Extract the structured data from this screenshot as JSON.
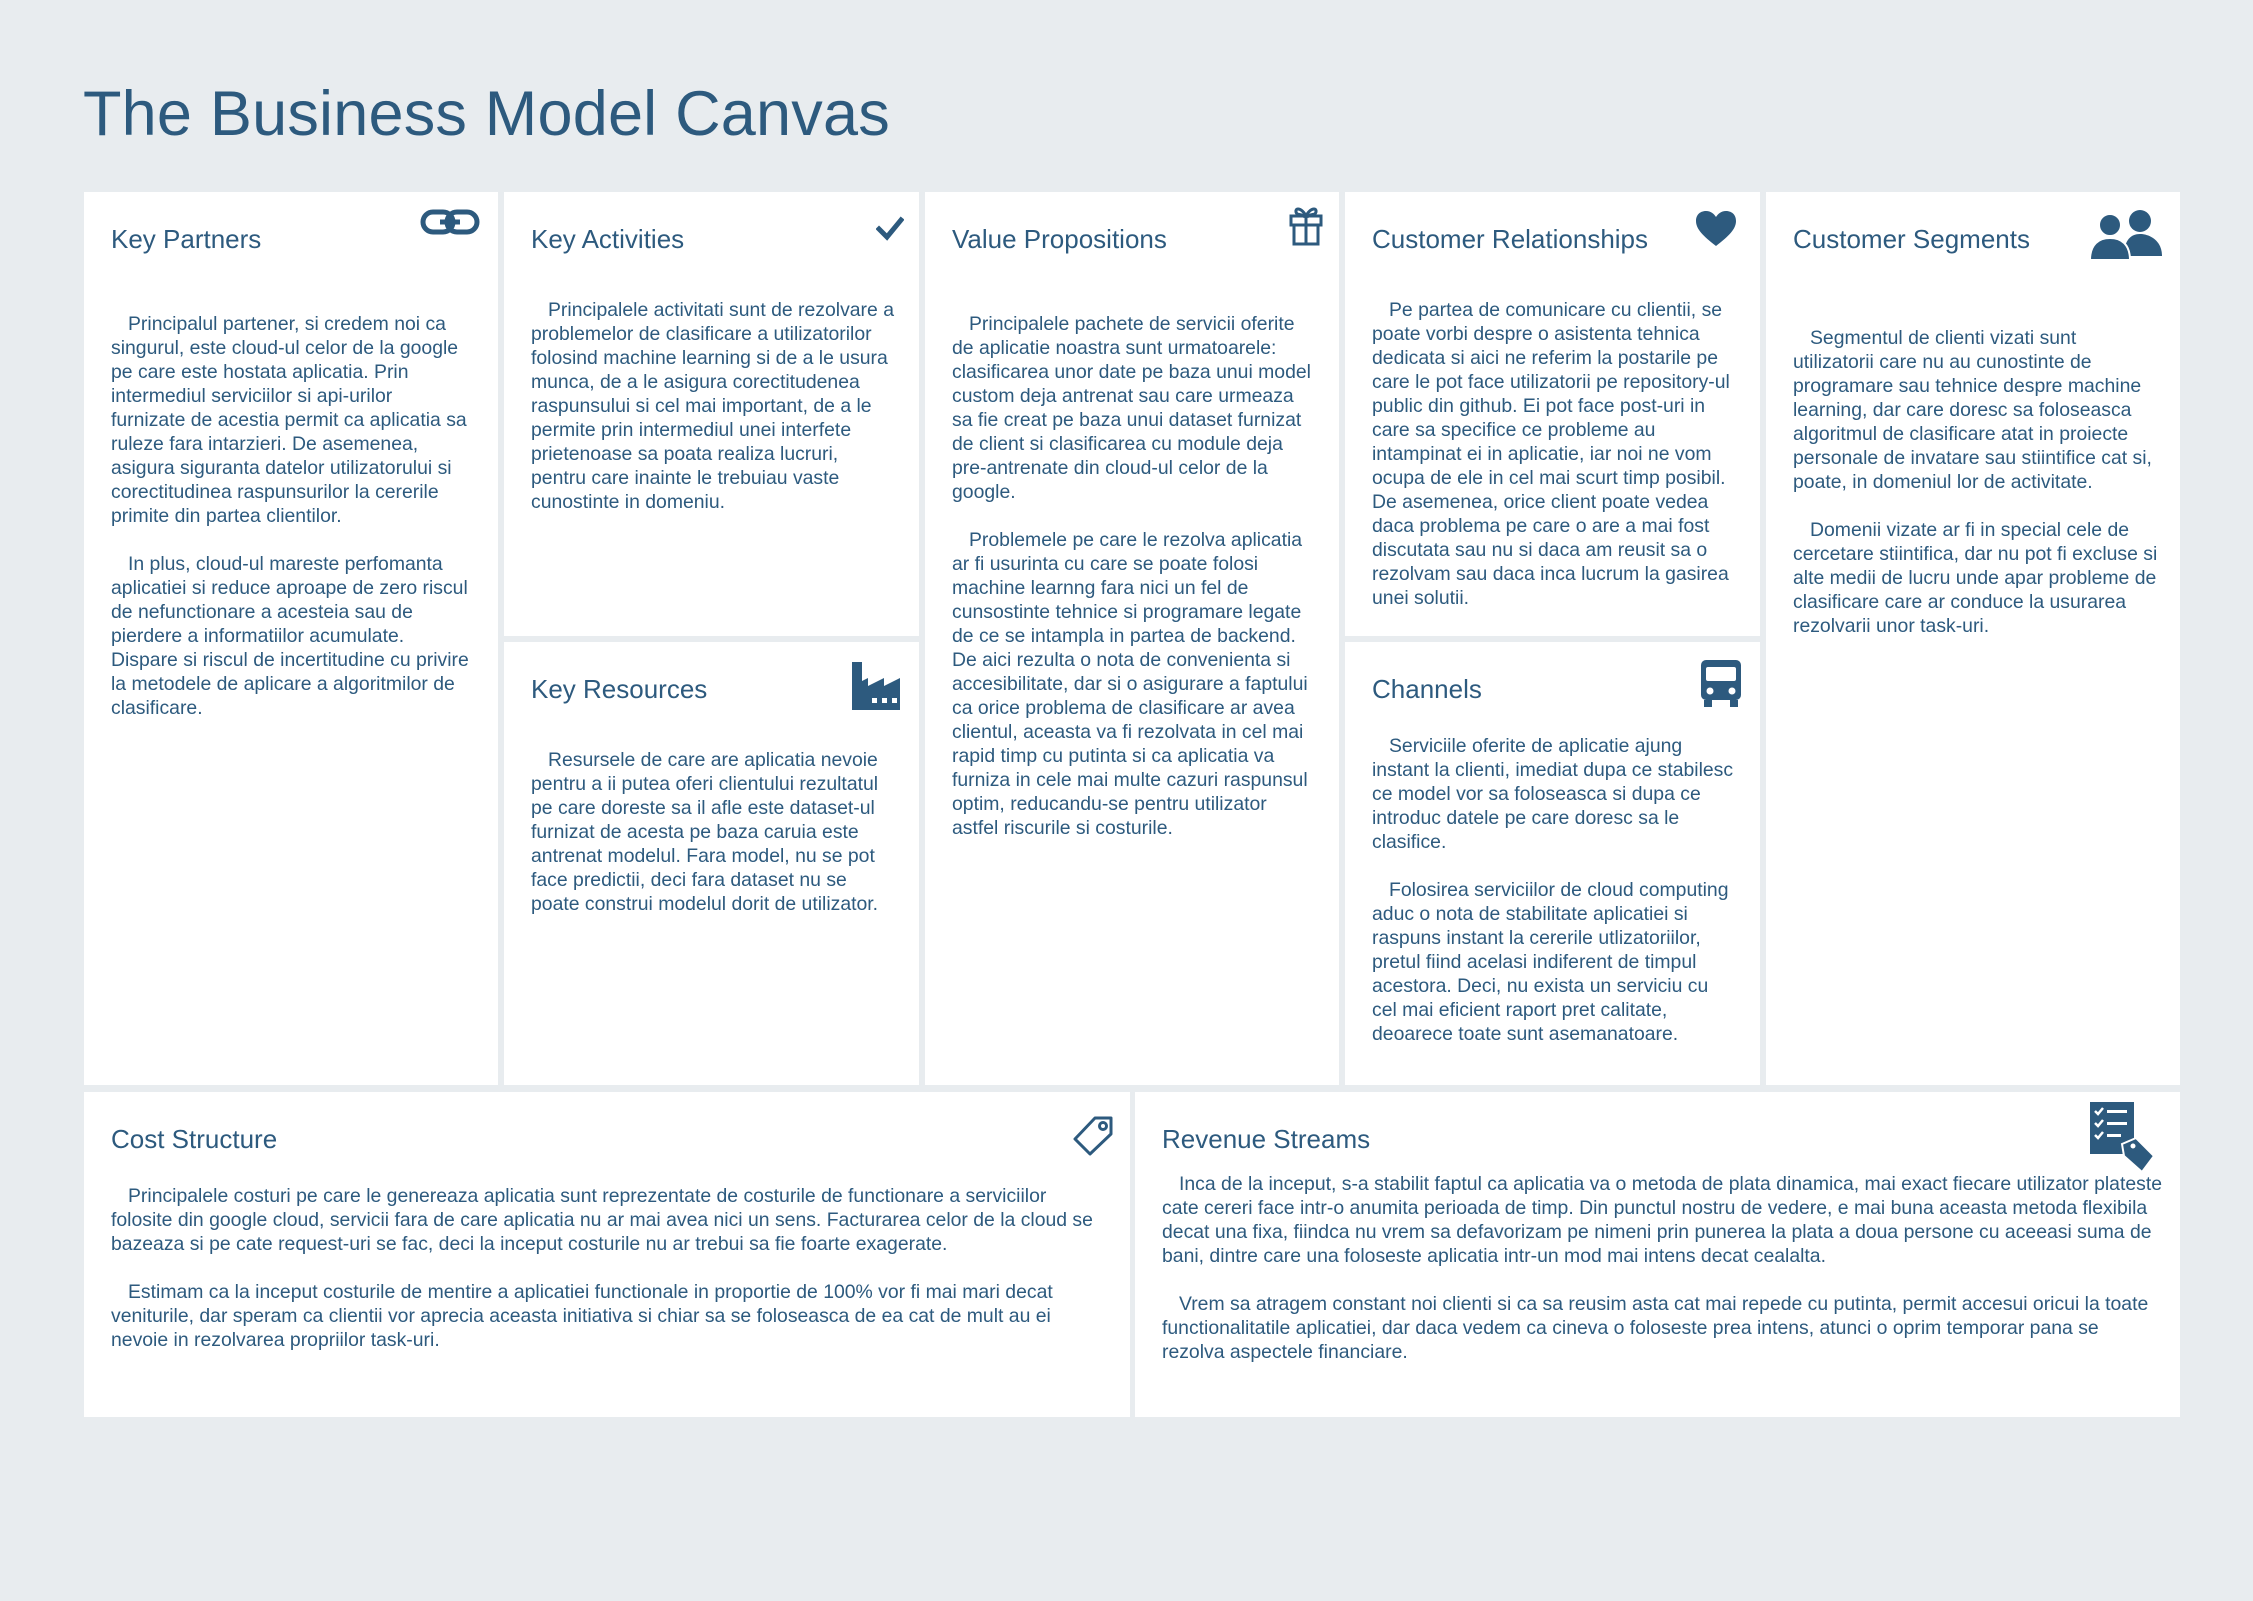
{
  "page_title": "The Business Model Canvas",
  "icons": {
    "key_partners": "link-icon",
    "key_activities": "checkmark-icon",
    "value_propositions": "gift-icon",
    "customer_relationships": "heart-icon",
    "customer_segments": "users-icon",
    "key_resources": "factory-icon",
    "channels": "truck-icon",
    "cost_structure": "price-tag-icon",
    "revenue_streams": "checklist-tag-icon"
  },
  "colors": {
    "background": "#e8ecef",
    "panel": "#ffffff",
    "accent": "#2d5a7e"
  },
  "key_partners": {
    "title": "Key Partners",
    "paragraphs": [
      "Principalul partener, si credem noi ca singurul, este cloud-ul celor de la google pe care este hostata aplicatia. Prin intermediul serviciilor si api-urilor furnizate de acestia permit ca aplicatia sa ruleze fara intarzieri. De asemenea, asigura siguranta datelor utilizatorului si corectitudinea raspunsurilor la cererile primite din partea clientilor.",
      "In plus, cloud-ul mareste perfomanta aplicatiei si reduce aproape de zero riscul de nefunctionare a acesteia sau de pierdere a informatiilor acumulate. Dispare si riscul de incertitudine cu privire la metodele de aplicare a algoritmilor de clasificare."
    ]
  },
  "key_activities": {
    "title": "Key Activities",
    "paragraphs": [
      "Principalele activitati sunt de rezolvare a problemelor de clasificare a utilizatorilor folosind machine learning  si de a le usura munca, de a le asigura corectitudenea raspunsului si cel mai important, de a le permite prin intermediul unei interfete prietenoase sa poata realiza lucruri, pentru care inainte le trebuiau vaste cunostinte in domeniu."
    ]
  },
  "key_resources": {
    "title": "Key Resources",
    "paragraphs": [
      "Resursele de care are aplicatia nevoie pentru a ii putea oferi clientului rezultatul pe care doreste sa il afle este dataset-ul furnizat de acesta pe baza caruia este antrenat modelul. Fara model, nu se pot face predictii, deci fara dataset nu se poate construi modelul dorit de utilizator."
    ]
  },
  "value_propositions": {
    "title": "Value Propositions",
    "paragraphs": [
      "Principalele pachete de servicii oferite de aplicatie noastra sunt urmatoarele: clasificarea unor date pe baza unui model custom deja antrenat sau care urmeaza sa fie creat pe baza unui dataset furnizat de client si clasificarea cu module deja pre-antrenate din cloud-ul celor de la google.",
      "Problemele pe care le rezolva aplicatia ar fi usurinta cu care se poate folosi machine learnng fara nici un fel de cunsostinte tehnice si programare legate de ce se intampla in partea de backend. De aici rezulta o nota de convenienta si accesibilitate, dar si o asigurare a faptului ca orice problema de clasificare ar avea clientul, aceasta va fi rezolvata in cel mai rapid timp cu putinta si ca aplicatia va furniza in cele mai multe cazuri raspunsul optim, reducandu-se pentru utilizator astfel riscurile si costurile."
    ]
  },
  "customer_relationships": {
    "title": "Customer Relationships",
    "paragraphs": [
      "Pe partea de comunicare cu clientii, se poate vorbi despre o asistenta tehnica dedicata si aici ne referim la postarile pe care le pot face utilizatorii pe repository-ul public din github. Ei pot face post-uri in care sa specifice ce probleme au intampinat ei in aplicatie, iar noi ne vom ocupa de ele in cel mai scurt timp posibil. De asemenea, orice client poate vedea daca problema pe care o are a mai fost discutata sau nu si daca am reusit sa o rezolvam sau daca inca lucrum la gasirea unei solutii."
    ]
  },
  "channels": {
    "title": "Channels",
    "paragraphs": [
      "Serviciile oferite de aplicatie ajung instant la clienti, imediat dupa ce stabilesc ce model vor sa foloseasca si dupa ce introduc datele pe care doresc sa le clasifice.",
      "Folosirea serviciilor de cloud computing aduc o nota de stabilitate aplicatiei si raspuns instant la cererile utlizatoriilor, pretul fiind acelasi indiferent de timpul acestora. Deci, nu exista un serviciu cu cel mai eficient raport pret calitate, deoarece toate sunt asemanatoare."
    ]
  },
  "customer_segments": {
    "title": "Customer Segments",
    "paragraphs": [
      "Segmentul de clienti vizati sunt utilizatorii care nu au cunostinte de programare sau tehnice despre machine learning, dar care doresc sa foloseasca algoritmul de clasificare atat in proiecte personale de invatare sau stiintifice cat si, poate, in domeniul lor de activitate.",
      "Domenii vizate ar fi in special cele de cercetare stiintifica, dar nu pot fi excluse si alte medii de lucru unde apar probleme de clasificare care ar conduce la usurarea rezolvarii unor task-uri."
    ]
  },
  "cost_structure": {
    "title": "Cost Structure",
    "paragraphs": [
      "Principalele costuri pe care le genereaza aplicatia sunt reprezentate de costurile de functionare a serviciilor folosite din google cloud, servicii fara de care aplicatia nu ar mai avea nici un sens. Facturarea celor de la cloud se bazeaza si pe cate request-uri se fac, deci la inceput costurile nu ar trebui sa fie foarte exagerate.",
      "Estimam ca la inceput costurile de mentire a aplicatiei functionale in proportie de 100% vor fi mai mari decat veniturile, dar speram ca clientii vor aprecia aceasta initiativa si chiar sa se foloseasca de ea cat de mult au ei nevoie in rezolvarea propriilor task-uri."
    ]
  },
  "revenue_streams": {
    "title": "Revenue Streams",
    "paragraphs": [
      "Inca de la inceput, s-a stabilit faptul ca aplicatia va o metoda de plata dinamica, mai exact fiecare utilizator plateste cate cereri face intr-o anumita perioada de timp. Din punctul nostru de vedere, e mai buna aceasta metoda flexibila decat una fixa, fiindca nu vrem sa defavorizam pe nimeni prin punerea la plata a doua persone cu aceeasi suma de bani, dintre care una foloseste aplicatia intr-un mod mai intens decat cealalta.",
      "Vrem sa atragem constant noi clienti si ca sa reusim asta cat mai repede cu putinta, permit accesui oricui la toate functionalitatile aplicatiei, dar daca vedem ca cineva o foloseste prea intens, atunci o oprim temporar pana se rezolva aspectele financiare."
    ]
  }
}
